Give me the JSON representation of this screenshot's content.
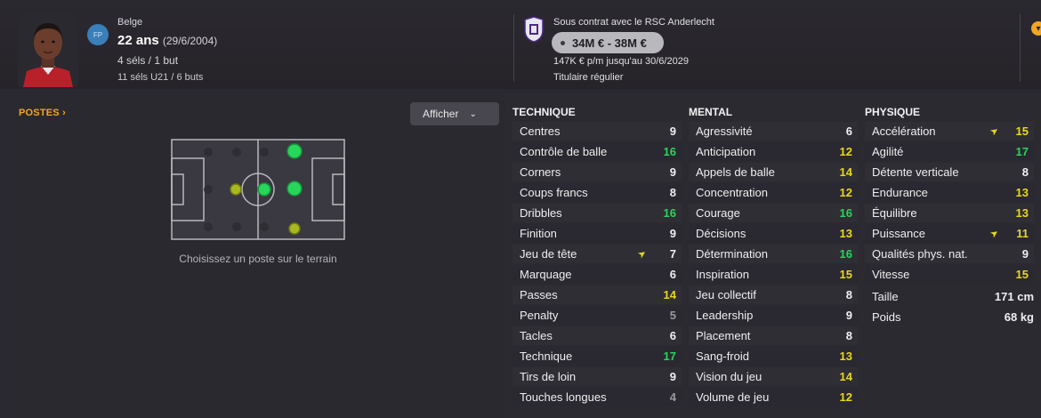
{
  "header": {
    "nationality": "Belge",
    "position_badge": "FP",
    "age": "22 ans",
    "dob": "(29/6/2004)",
    "caps": "4 séls / 1 but",
    "u21_caps": "11 séls U21 / 6 buts",
    "contract": "Sous contrat avec le RSC Anderlecht",
    "value": "34M € - 38M €",
    "wage": "147K € p/m jusqu'au 30/6/2029",
    "status": "Titulaire régulier"
  },
  "positions": {
    "title": "POSTES",
    "display_button": "Afficher",
    "hint": "Choisissez un poste sur le terrain"
  },
  "colors": {
    "accent": "#f2a623",
    "high": "#27d65a",
    "medium": "#e8d81a",
    "low": "#9a999e"
  },
  "technique": {
    "title": "TECHNIQUE",
    "items": [
      {
        "label": "Centres",
        "value": "9",
        "tier": "w"
      },
      {
        "label": "Contrôle de balle",
        "value": "16",
        "tier": "g"
      },
      {
        "label": "Corners",
        "value": "9",
        "tier": "w"
      },
      {
        "label": "Coups francs",
        "value": "8",
        "tier": "w"
      },
      {
        "label": "Dribbles",
        "value": "16",
        "tier": "g"
      },
      {
        "label": "Finition",
        "value": "9",
        "tier": "w"
      },
      {
        "label": "Jeu de tête",
        "value": "7",
        "tier": "w",
        "arrow": true
      },
      {
        "label": "Marquage",
        "value": "6",
        "tier": "w"
      },
      {
        "label": "Passes",
        "value": "14",
        "tier": "y"
      },
      {
        "label": "Penalty",
        "value": "5",
        "tier": "gr"
      },
      {
        "label": "Tacles",
        "value": "6",
        "tier": "w"
      },
      {
        "label": "Technique",
        "value": "17",
        "tier": "g"
      },
      {
        "label": "Tirs de loin",
        "value": "9",
        "tier": "w"
      },
      {
        "label": "Touches longues",
        "value": "4",
        "tier": "gr"
      }
    ]
  },
  "mental": {
    "title": "MENTAL",
    "items": [
      {
        "label": "Agressivité",
        "value": "6",
        "tier": "w"
      },
      {
        "label": "Anticipation",
        "value": "12",
        "tier": "y"
      },
      {
        "label": "Appels de balle",
        "value": "14",
        "tier": "y"
      },
      {
        "label": "Concentration",
        "value": "12",
        "tier": "y"
      },
      {
        "label": "Courage",
        "value": "16",
        "tier": "g"
      },
      {
        "label": "Décisions",
        "value": "13",
        "tier": "y"
      },
      {
        "label": "Détermination",
        "value": "16",
        "tier": "g"
      },
      {
        "label": "Inspiration",
        "value": "15",
        "tier": "y"
      },
      {
        "label": "Jeu collectif",
        "value": "8",
        "tier": "w"
      },
      {
        "label": "Leadership",
        "value": "9",
        "tier": "w"
      },
      {
        "label": "Placement",
        "value": "8",
        "tier": "w"
      },
      {
        "label": "Sang-froid",
        "value": "13",
        "tier": "y"
      },
      {
        "label": "Vision du jeu",
        "value": "14",
        "tier": "y"
      },
      {
        "label": "Volume de jeu",
        "value": "12",
        "tier": "y"
      }
    ]
  },
  "physique": {
    "title": "PHYSIQUE",
    "items": [
      {
        "label": "Accélération",
        "value": "15",
        "tier": "y",
        "arrow": true
      },
      {
        "label": "Agilité",
        "value": "17",
        "tier": "g"
      },
      {
        "label": "Détente verticale",
        "value": "8",
        "tier": "w"
      },
      {
        "label": "Endurance",
        "value": "13",
        "tier": "y"
      },
      {
        "label": "Équilibre",
        "value": "13",
        "tier": "y"
      },
      {
        "label": "Puissance",
        "value": "11",
        "tier": "y",
        "arrow": true
      },
      {
        "label": "Qualités phys. nat.",
        "value": "9",
        "tier": "w"
      },
      {
        "label": "Vitesse",
        "value": "15",
        "tier": "y"
      }
    ],
    "height_label": "Taille",
    "height_value": "171 cm",
    "weight_label": "Poids",
    "weight_value": "68 kg"
  }
}
